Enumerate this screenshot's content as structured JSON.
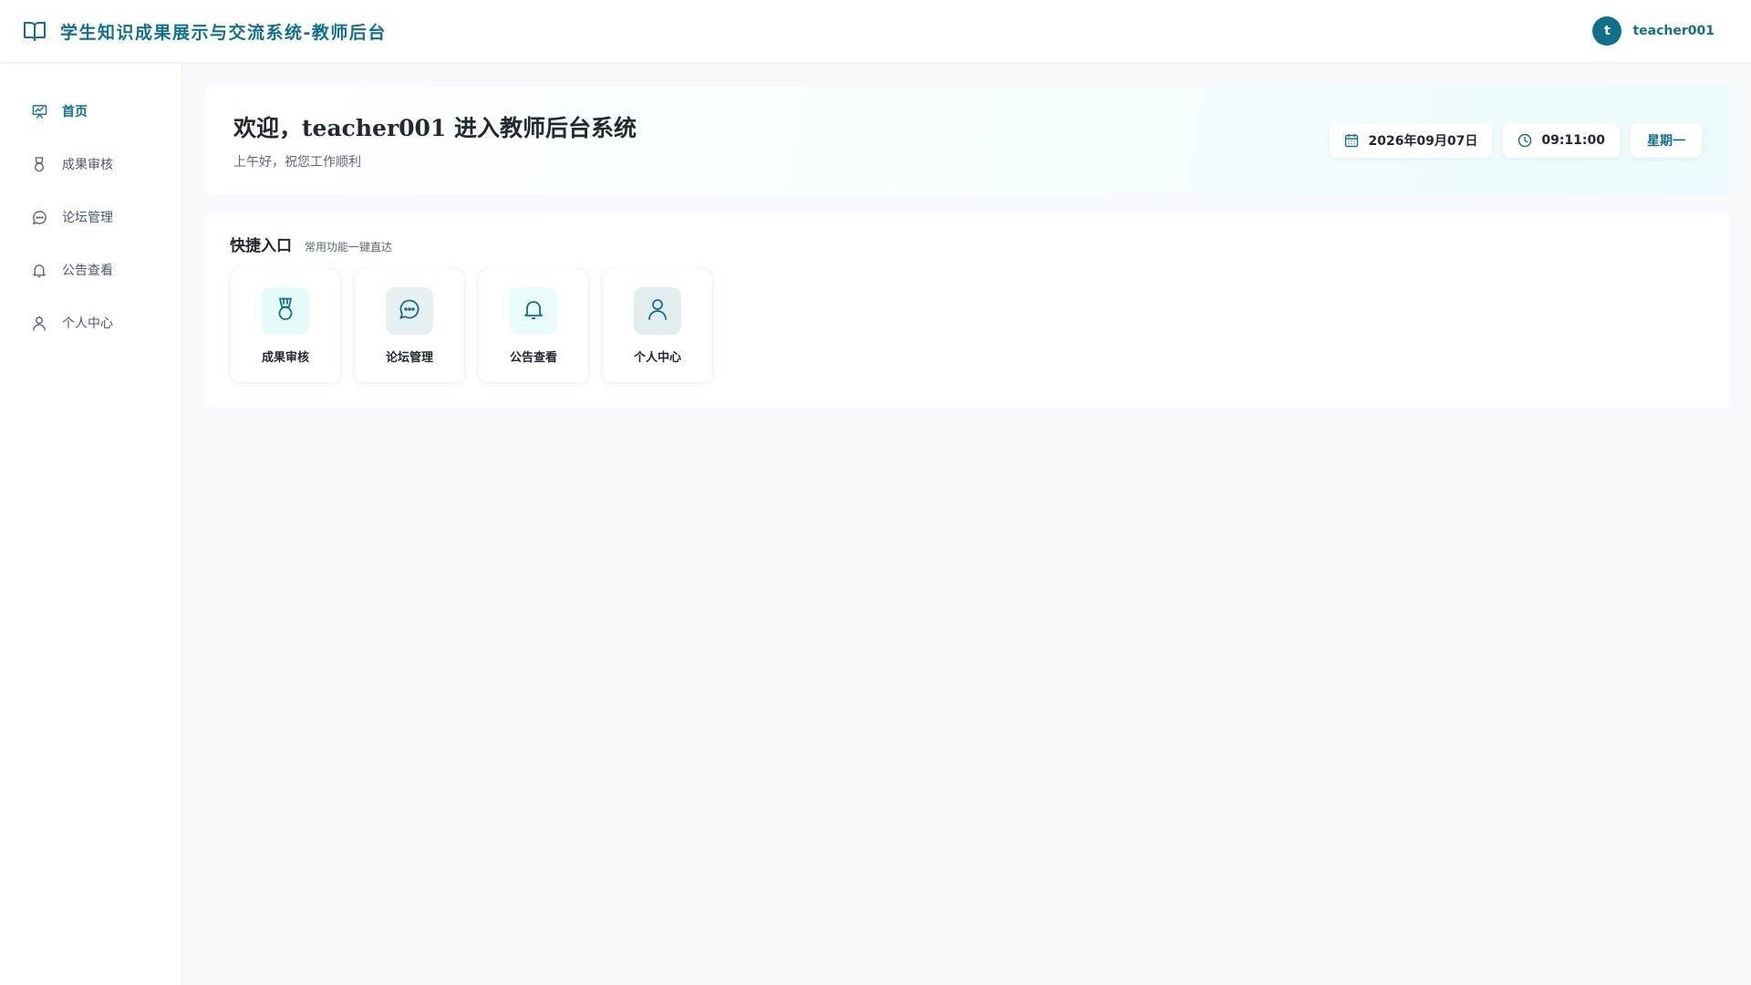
{
  "header": {
    "title": "学生知识成果展示与交流系统-教师后台",
    "logo_icon": "book-open-icon",
    "user": {
      "avatar_letter": "t",
      "username": "teacher001"
    }
  },
  "sidebar": {
    "items": [
      {
        "label": "首页",
        "icon": "dashboard-icon",
        "active": true
      },
      {
        "label": "成果审核",
        "icon": "medal-icon",
        "active": false
      },
      {
        "label": "论坛管理",
        "icon": "chat-icon",
        "active": false
      },
      {
        "label": "公告查看",
        "icon": "bell-icon",
        "active": false
      },
      {
        "label": "个人中心",
        "icon": "user-icon",
        "active": false
      }
    ]
  },
  "welcome": {
    "title": "欢迎，teacher001 进入教师后台系统",
    "subtitle": "上午好，祝您工作顺利",
    "date": "2026年09月07日",
    "time": "09:11:00",
    "weekday": "星期一"
  },
  "quick": {
    "title": "快捷入口",
    "subtitle": "常用功能一键直达",
    "cards": [
      {
        "label": "成果审核",
        "icon": "medal-icon"
      },
      {
        "label": "论坛管理",
        "icon": "chat-icon"
      },
      {
        "label": "公告查看",
        "icon": "bell-icon"
      },
      {
        "label": "个人中心",
        "icon": "user-icon"
      }
    ]
  },
  "colors": {
    "primary": "#13708a",
    "background": "#f7f9fb",
    "text": "#22292f"
  }
}
